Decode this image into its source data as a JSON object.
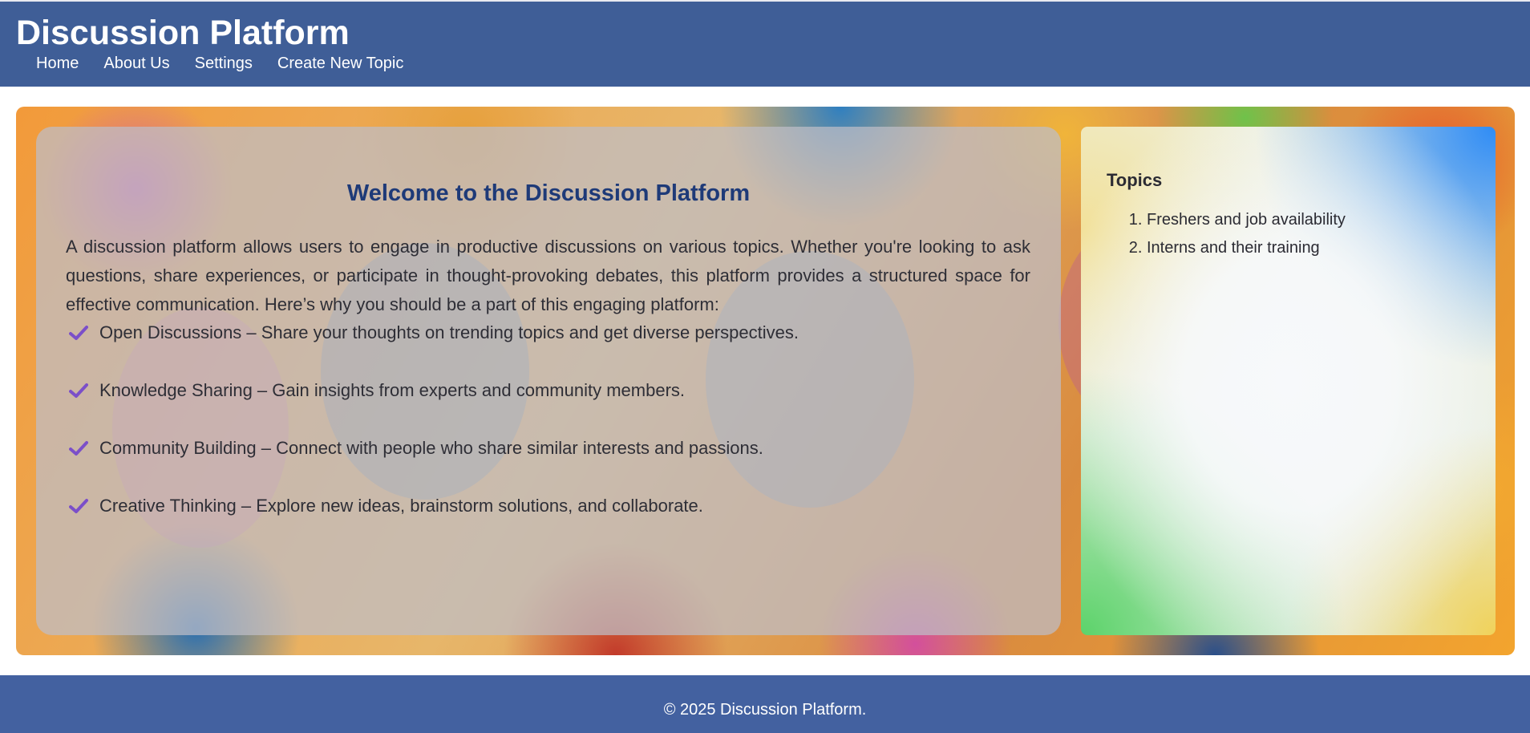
{
  "header": {
    "title": "Discussion Platform",
    "nav": [
      {
        "label": "Home"
      },
      {
        "label": "About Us"
      },
      {
        "label": "Settings"
      },
      {
        "label": "Create New Topic"
      }
    ]
  },
  "main": {
    "welcome": {
      "title": "Welcome to the Discussion Platform",
      "intro": "A discussion platform allows users to engage in productive discussions on various topics. Whether you're looking to ask questions, share experiences, or participate in thought-provoking debates, this platform provides a structured space for effective communication. Here’s why you should be a part of this engaging platform:",
      "features": [
        "Open Discussions – Share your thoughts on trending topics and get diverse perspectives.",
        "Knowledge Sharing – Gain insights from experts and community members.",
        "Community Building – Connect with people who share similar interests and passions.",
        "Creative Thinking – Explore new ideas, brainstorm solutions, and collaborate."
      ]
    },
    "topics": {
      "title": "Topics",
      "items": [
        "Freshers and job availability",
        "Interns and their training"
      ]
    }
  },
  "footer": {
    "text": "© 2025 Discussion Platform."
  },
  "colors": {
    "header_bg": "#3f5e97",
    "footer_bg": "#4361a0",
    "welcome_title": "#1e3a78",
    "check_icon": "#7b4fc9"
  }
}
